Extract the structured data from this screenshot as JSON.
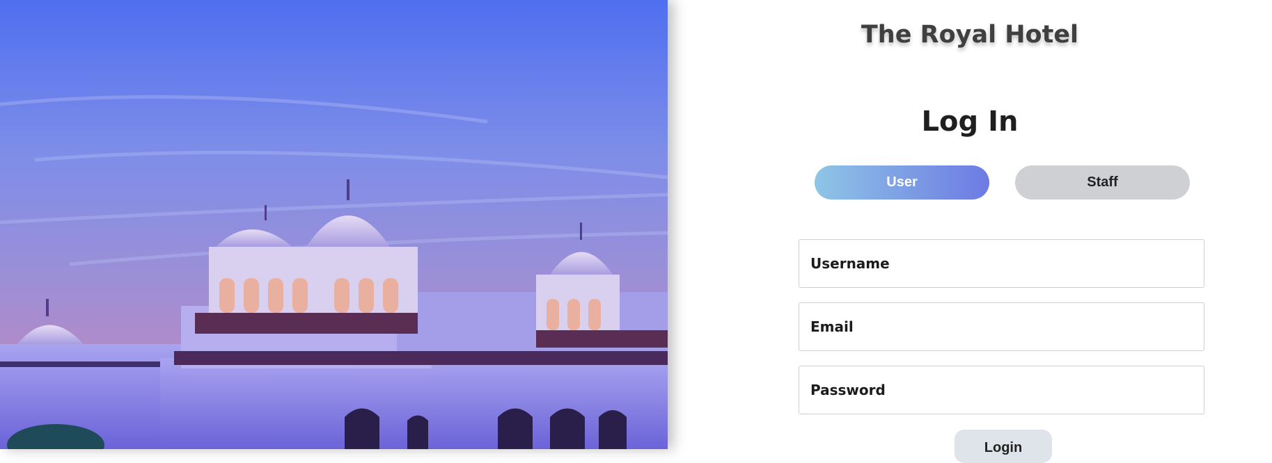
{
  "hero": {
    "image_label": "palace-at-dusk"
  },
  "brand": {
    "title": "The Royal Hotel"
  },
  "login": {
    "heading": "Log In",
    "tabs": [
      {
        "label": "User",
        "active": true
      },
      {
        "label": "Staff",
        "active": false
      }
    ],
    "fields": {
      "username_placeholder": "Username",
      "email_placeholder": "Email",
      "password_placeholder": "Password"
    },
    "submit_label": "Login"
  },
  "colors": {
    "user_tab_gradient_start": "#8ec5e6",
    "user_tab_gradient_end": "#6d7ae3",
    "staff_tab": "#cfd0d3",
    "submit_button": "#dfe3ea"
  }
}
